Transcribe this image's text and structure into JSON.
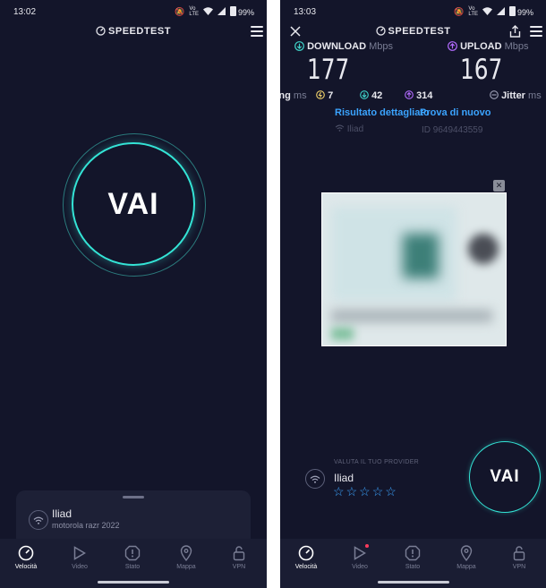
{
  "left": {
    "status": {
      "time": "13:02",
      "battery": "99%",
      "net_small": "4G"
    },
    "logo": "SPEEDTEST",
    "go_button": "VAI",
    "provider_card": {
      "name": "Iliad",
      "device": "motorola razr 2022"
    },
    "nav": [
      {
        "label": "Velocità",
        "icon": "speedometer-icon"
      },
      {
        "label": "Video",
        "icon": "play-icon"
      },
      {
        "label": "Stato",
        "icon": "alert-icon"
      },
      {
        "label": "Mappa",
        "icon": "map-pin-icon"
      },
      {
        "label": "VPN",
        "icon": "lock-icon"
      }
    ]
  },
  "right": {
    "status": {
      "time": "13:03",
      "battery": "99%",
      "net_small": "4G"
    },
    "logo": "SPEEDTEST",
    "download": {
      "label": "DOWNLOAD",
      "unit": "Mbps",
      "value": "177"
    },
    "upload": {
      "label": "UPLOAD",
      "unit": "Mbps",
      "value": "167"
    },
    "ping": {
      "label": "Ping",
      "unit": "ms",
      "idle": "7",
      "down": "42",
      "up": "314"
    },
    "jitter": {
      "label": "Jitter",
      "unit": "ms"
    },
    "links": {
      "details": "Risultato dettagliato",
      "retry": "Prova di nuovo"
    },
    "provider": "Iliad",
    "result_id": "ID 9649443559",
    "ad_close": "✕",
    "rate": {
      "label": "VALUTA IL TUO PROVIDER",
      "provider": "Iliad",
      "stars": 0,
      "max_stars": 5
    },
    "go_button": "VAI",
    "nav": [
      {
        "label": "Velocità",
        "icon": "speedometer-icon"
      },
      {
        "label": "Video",
        "icon": "play-icon"
      },
      {
        "label": "Stato",
        "icon": "alert-icon"
      },
      {
        "label": "Mappa",
        "icon": "map-pin-icon"
      },
      {
        "label": "VPN",
        "icon": "lock-icon"
      }
    ]
  },
  "colors": {
    "background": "#13152a",
    "accent_teal": "#34e4d6",
    "download_teal": "#3fd3c9",
    "upload_purple": "#b36bff",
    "link_blue": "#3ba4ff",
    "star_blue": "#3ba4ff",
    "ping_yellow": "#f2d36b"
  }
}
